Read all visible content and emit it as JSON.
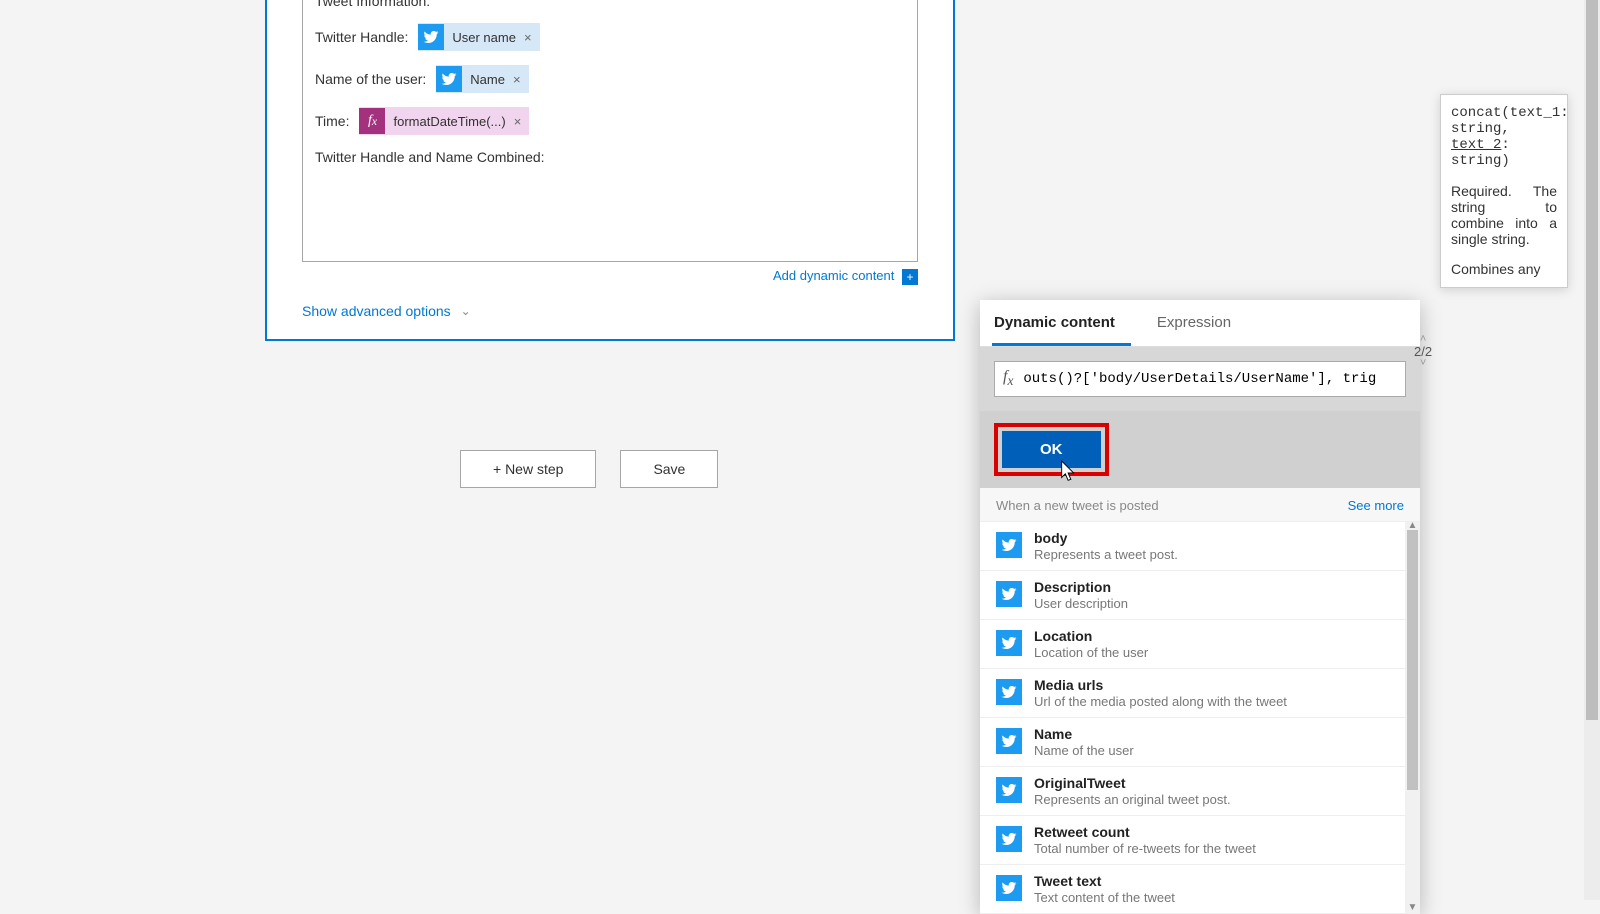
{
  "form": {
    "header_line": "Tweet Information:",
    "fields": {
      "twitter_handle_label": "Twitter Handle:",
      "twitter_handle_token": "User name",
      "name_label": "Name of the user:",
      "name_token": "Name",
      "time_label": "Time:",
      "time_token": "formatDateTime(...)",
      "combined_label": "Twitter Handle and Name Combined:"
    },
    "add_dynamic": "Add dynamic content",
    "show_advanced": "Show advanced options"
  },
  "buttons": {
    "new_step": "+ New step",
    "save": "Save"
  },
  "panel": {
    "tab_dynamic": "Dynamic content",
    "tab_expression": "Expression",
    "expression_text": "outs()?['body/UserDetails/UserName'], trig",
    "ok": "OK",
    "section_title": "When a new tweet is posted",
    "see_more": "See more",
    "items": [
      {
        "title": "body",
        "desc": "Represents a tweet post."
      },
      {
        "title": "Description",
        "desc": "User description"
      },
      {
        "title": "Location",
        "desc": "Location of the user"
      },
      {
        "title": "Media urls",
        "desc": "Url of the media posted along with the tweet"
      },
      {
        "title": "Name",
        "desc": "Name of the user"
      },
      {
        "title": "OriginalTweet",
        "desc": "Represents an original tweet post."
      },
      {
        "title": "Retweet count",
        "desc": "Total number of re-tweets for the tweet"
      },
      {
        "title": "Tweet text",
        "desc": "Text content of the tweet"
      }
    ]
  },
  "pager": "2/2",
  "tooltip": {
    "sig_1": "concat(text_1:",
    "sig_2": "string,",
    "sig_3": "text_2",
    "sig_4": ":",
    "sig_5": "string)",
    "desc1": "Required. The string to combine into a single string.",
    "desc2_partial": "Combines any"
  }
}
